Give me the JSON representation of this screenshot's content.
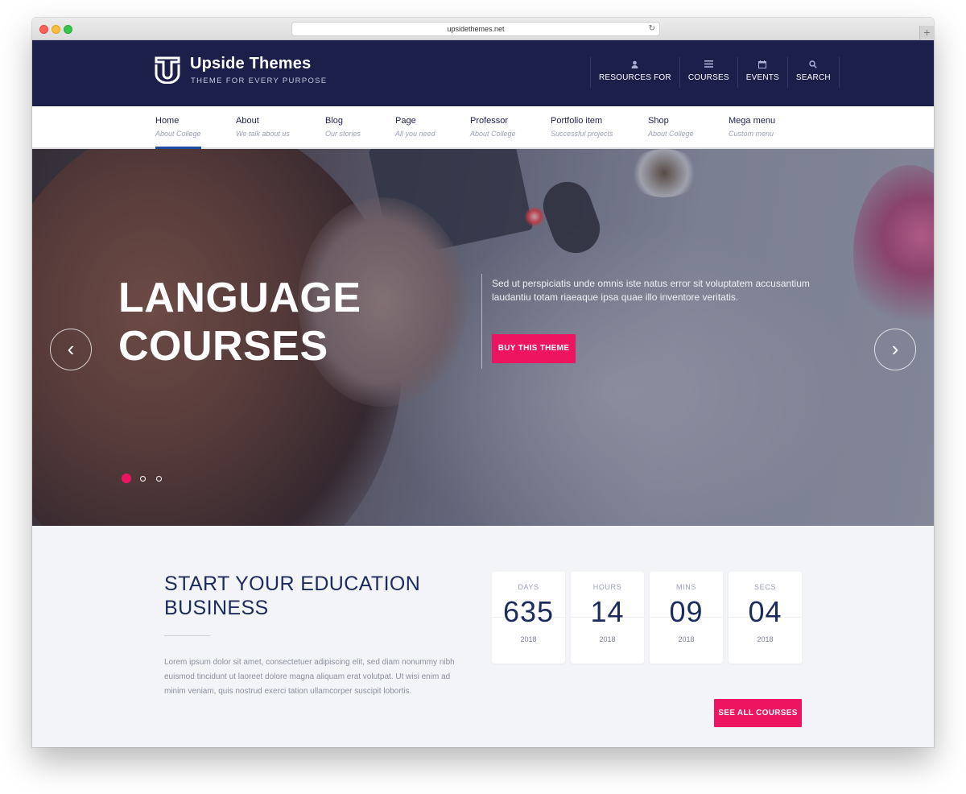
{
  "browser": {
    "url": "upsidethemes.net"
  },
  "header": {
    "brand_name": "Upside Themes",
    "brand_tagline": "THEME FOR EVERY PURPOSE",
    "nav": [
      {
        "label": "RESOURCES FOR",
        "icon": "user-icon"
      },
      {
        "label": "COURSES",
        "icon": "list-icon"
      },
      {
        "label": "EVENTS",
        "icon": "calendar-icon"
      },
      {
        "label": "SEARCH",
        "icon": "search-icon"
      }
    ]
  },
  "main_nav": {
    "items": [
      {
        "title": "Home",
        "subtitle": "About College",
        "active": true
      },
      {
        "title": "About",
        "subtitle": "We talk about us"
      },
      {
        "title": "Blog",
        "subtitle": "Our stories"
      },
      {
        "title": "Page",
        "subtitle": "All you need"
      },
      {
        "title": "Professor",
        "subtitle": "About College"
      },
      {
        "title": "Portfolio item",
        "subtitle": "Successful projects"
      },
      {
        "title": "Shop",
        "subtitle": "About College"
      },
      {
        "title": "Mega menu",
        "subtitle": "Custom menu"
      }
    ]
  },
  "hero": {
    "title_line1": "LANGUAGE",
    "title_line2": "COURSES",
    "description": "Sed ut perspiciatis unde omnis iste natus error sit voluptatem accusantium laudantiu totam riaeaque ipsa quae illo inventore veritatis.",
    "button_label": "BUY THIS THEME",
    "slide_count": 3,
    "active_slide": 1
  },
  "education": {
    "title": "START YOUR EDUCATION BUSINESS",
    "text": "Lorem ipsum dolor sit amet, consectetuer adipiscing elit, sed diam nonummy nibh euismod tincidunt ut laoreet dolore magna aliquam erat volutpat. Ut wisi enim ad minim veniam, quis nostrud exerci tation ullamcorper suscipit lobortis.",
    "button_label": "SEE ALL COURSES"
  },
  "countdown": [
    {
      "label": "DAYS",
      "value": "635",
      "year": "2018"
    },
    {
      "label": "HOURS",
      "value": "14",
      "year": "2018"
    },
    {
      "label": "MINS",
      "value": "09",
      "year": "2018"
    },
    {
      "label": "SECS",
      "value": "04",
      "year": "2018"
    }
  ],
  "colors": {
    "header_navy": "#1c1f4a",
    "accent_pink": "#ee1560",
    "title_navy": "#1c2b5e",
    "active_underline": "#1c4da0"
  }
}
